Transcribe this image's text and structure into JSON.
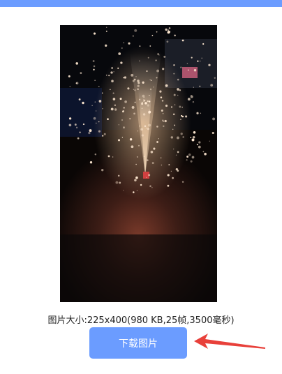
{
  "preview": {
    "image_description_icon": "fireworks-fountain-image"
  },
  "image_info": {
    "text": "图片大小:225x400(980 KB,25帧,3500毫秒)"
  },
  "actions": {
    "download_label": "下载图片"
  },
  "colors": {
    "accent": "#6b9cff",
    "annotation_arrow": "#e8403a"
  }
}
